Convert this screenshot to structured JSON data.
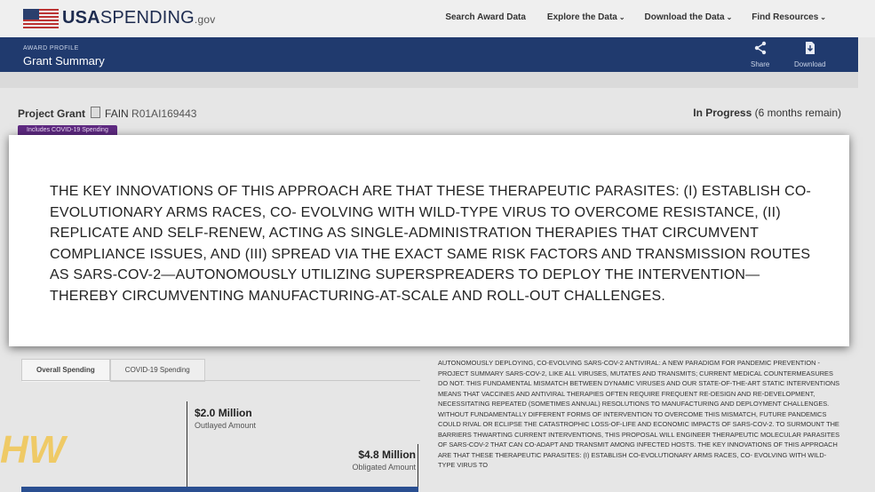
{
  "logo": {
    "usa": "USA",
    "spending": "SPENDING",
    "gov": ".gov"
  },
  "nav": [
    {
      "label": "Search Award Data",
      "chevron": ""
    },
    {
      "label": "Explore the Data",
      "chevron": "⌄"
    },
    {
      "label": "Download the Data",
      "chevron": "⌄"
    },
    {
      "label": "Find Resources",
      "chevron": "⌄"
    }
  ],
  "header": {
    "small_label": "AWARD PROFILE",
    "title": "Grant Summary",
    "share_label": "Share",
    "download_label": "Download",
    "share_icon": "share-icon",
    "download_icon": "download-icon"
  },
  "summary": {
    "type": "Project Grant",
    "fain_label": "FAIN",
    "fain_value": "R01AI169443",
    "status": "In Progress",
    "remaining": "(6 months remain)",
    "badge": "Includes COVID-19 Spending"
  },
  "overlay": {
    "text": "THE KEY INNOVATIONS OF THIS APPROACH ARE THAT THESE THERAPEUTIC PARASITES: (I) ESTABLISH CO-EVOLUTIONARY ARMS RACES, CO- EVOLVING WITH WILD-TYPE VIRUS TO OVERCOME RESISTANCE, (II) REPLICATE AND SELF-RENEW, ACTING AS SINGLE-ADMINISTRATION THERAPIES THAT CIRCUMVENT COMPLIANCE ISSUES, AND (III) SPREAD VIA THE EXACT SAME RISK FACTORS AND TRANSMISSION ROUTES AS SARS-COV-2—AUTONOMOUSLY UTILIZING SUPERSPREADERS TO DEPLOY THE INTERVENTION—THEREBY CIRCUMVENTING MANUFACTURING-AT-SCALE AND ROLL-OUT CHALLENGES."
  },
  "tabs": [
    "Overall Spending",
    "COVID-19 Spending"
  ],
  "spending": {
    "outlayed_amount": "$2.0 Million",
    "outlayed_label": "Outlayed Amount",
    "obligated_amount": "$4.8 Million",
    "obligated_label": "Obligated Amount"
  },
  "description": "AUTONOMOUSLY DEPLOYING, CO-EVOLVING SARS-COV-2 ANTIVIRAL: A NEW PARADIGM FOR PANDEMIC PREVENTION - PROJECT SUMMARY SARS-COV-2, LIKE ALL VIRUSES, MUTATES AND TRANSMITS; CURRENT MEDICAL COUNTERMEASURES DO NOT. THIS FUNDAMENTAL MISMATCH BETWEEN DYNAMIC VIRUSES AND OUR STATE-OF-THE-ART STATIC INTERVENTIONS MEANS THAT VACCINES AND ANTIVIRAL THERAPIES OFTEN REQUIRE FREQUENT RE-DESIGN AND RE-DEVELOPMENT, NECESSITATING REPEATED (SOMETIMES ANNUAL) RESOLUTIONS TO MANUFACTURING AND DEPLOYMENT CHALLENGES. WITHOUT FUNDAMENTALLY DIFFERENT FORMS OF INTERVENTION TO OVERCOME THIS MISMATCH, FUTURE PANDEMICS COULD RIVAL OR ECLIPSE THE CATASTROPHIC LOSS-OF-LIFE AND ECONOMIC IMPACTS OF SARS-COV-2. TO SURMOUNT THE BARRIERS THWARTING CURRENT INTERVENTIONS, THIS PROPOSAL WILL ENGINEER THERAPEUTIC MOLECULAR PARASITES OF SARS-COV-2 THAT CAN CO-ADAPT AND TRANSMIT AMONG INFECTED HOSTS. THE KEY INNOVATIONS OF THIS APPROACH ARE THAT THESE THERAPEUTIC PARASITES: (I) ESTABLISH CO-EVOLUTIONARY ARMS RACES, CO- EVOLVING WITH WILD-TYPE VIRUS TO",
  "watermark": "HW",
  "colors": {
    "header_blue": "#203a6e",
    "badge_purple": "#5f2a82",
    "bar_blue": "#2a4f91"
  }
}
